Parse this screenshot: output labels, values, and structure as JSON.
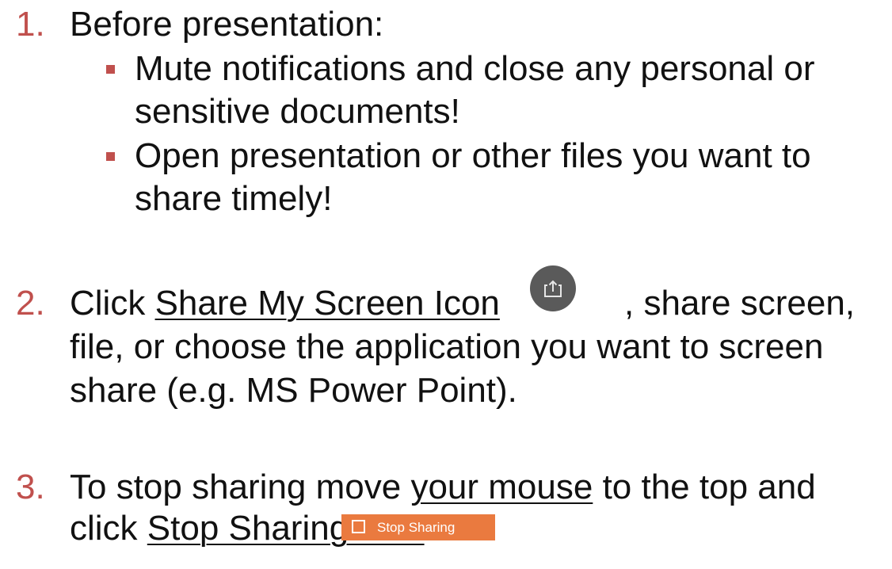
{
  "steps": [
    {
      "number": "1.",
      "title": "Before presentation:",
      "bullets": [
        {
          "line1": "Mute notifications and close any personal or",
          "line2": "sensitive documents!"
        },
        {
          "line1": "Open presentation or other files you want to",
          "line2": "share timely!"
        }
      ]
    },
    {
      "number": "2.",
      "prefix": "Click ",
      "link": "Share My Screen Icon",
      "suffix": ", share screen,",
      "line2": "file, or choose the application you want to screen",
      "line3": "share (e.g. MS Power Point).",
      "icon": "share-screen-icon"
    },
    {
      "number": "3.",
      "line1_pre": "To stop sharing move ",
      "line1_link": "your mouse",
      "line1_post": " to the top and",
      "line2_pre": "click ",
      "line2_link": "Stop Sharing Icon",
      "button_label": "Stop Sharing",
      "button_color": "#ea7a3f"
    }
  ],
  "colors": {
    "accent": "#c0504d",
    "text": "#111111",
    "share_icon_bg": "#5a5a5a"
  }
}
